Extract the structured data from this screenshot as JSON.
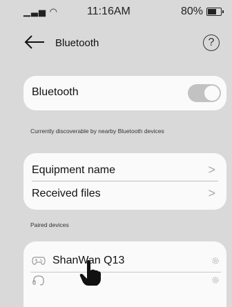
{
  "status_bar": {
    "signal": "▁▃▅ ◠",
    "time": "11:16AM",
    "battery": "80%"
  },
  "header": {
    "title": "Bluetooth",
    "help": "?"
  },
  "bluetooth_card": {
    "label": "Bluetooth",
    "enabled": true
  },
  "discoverable_text": "Currently discoverable by nearby Bluetooth devices",
  "settings_card": {
    "rows": [
      {
        "label": "Equipment name",
        "chevron": ">"
      },
      {
        "label": "Received files",
        "chevron": ">"
      }
    ]
  },
  "paired_section": {
    "heading": "Paired devices",
    "devices": [
      {
        "name": "ShanWan Q13",
        "icon": "gamepad-icon"
      },
      {
        "name": "",
        "icon": "headset-icon"
      }
    ]
  },
  "colors": {
    "background": "#d9d9d9",
    "card": "#fafafa",
    "toggle": "#c2c2c2"
  }
}
